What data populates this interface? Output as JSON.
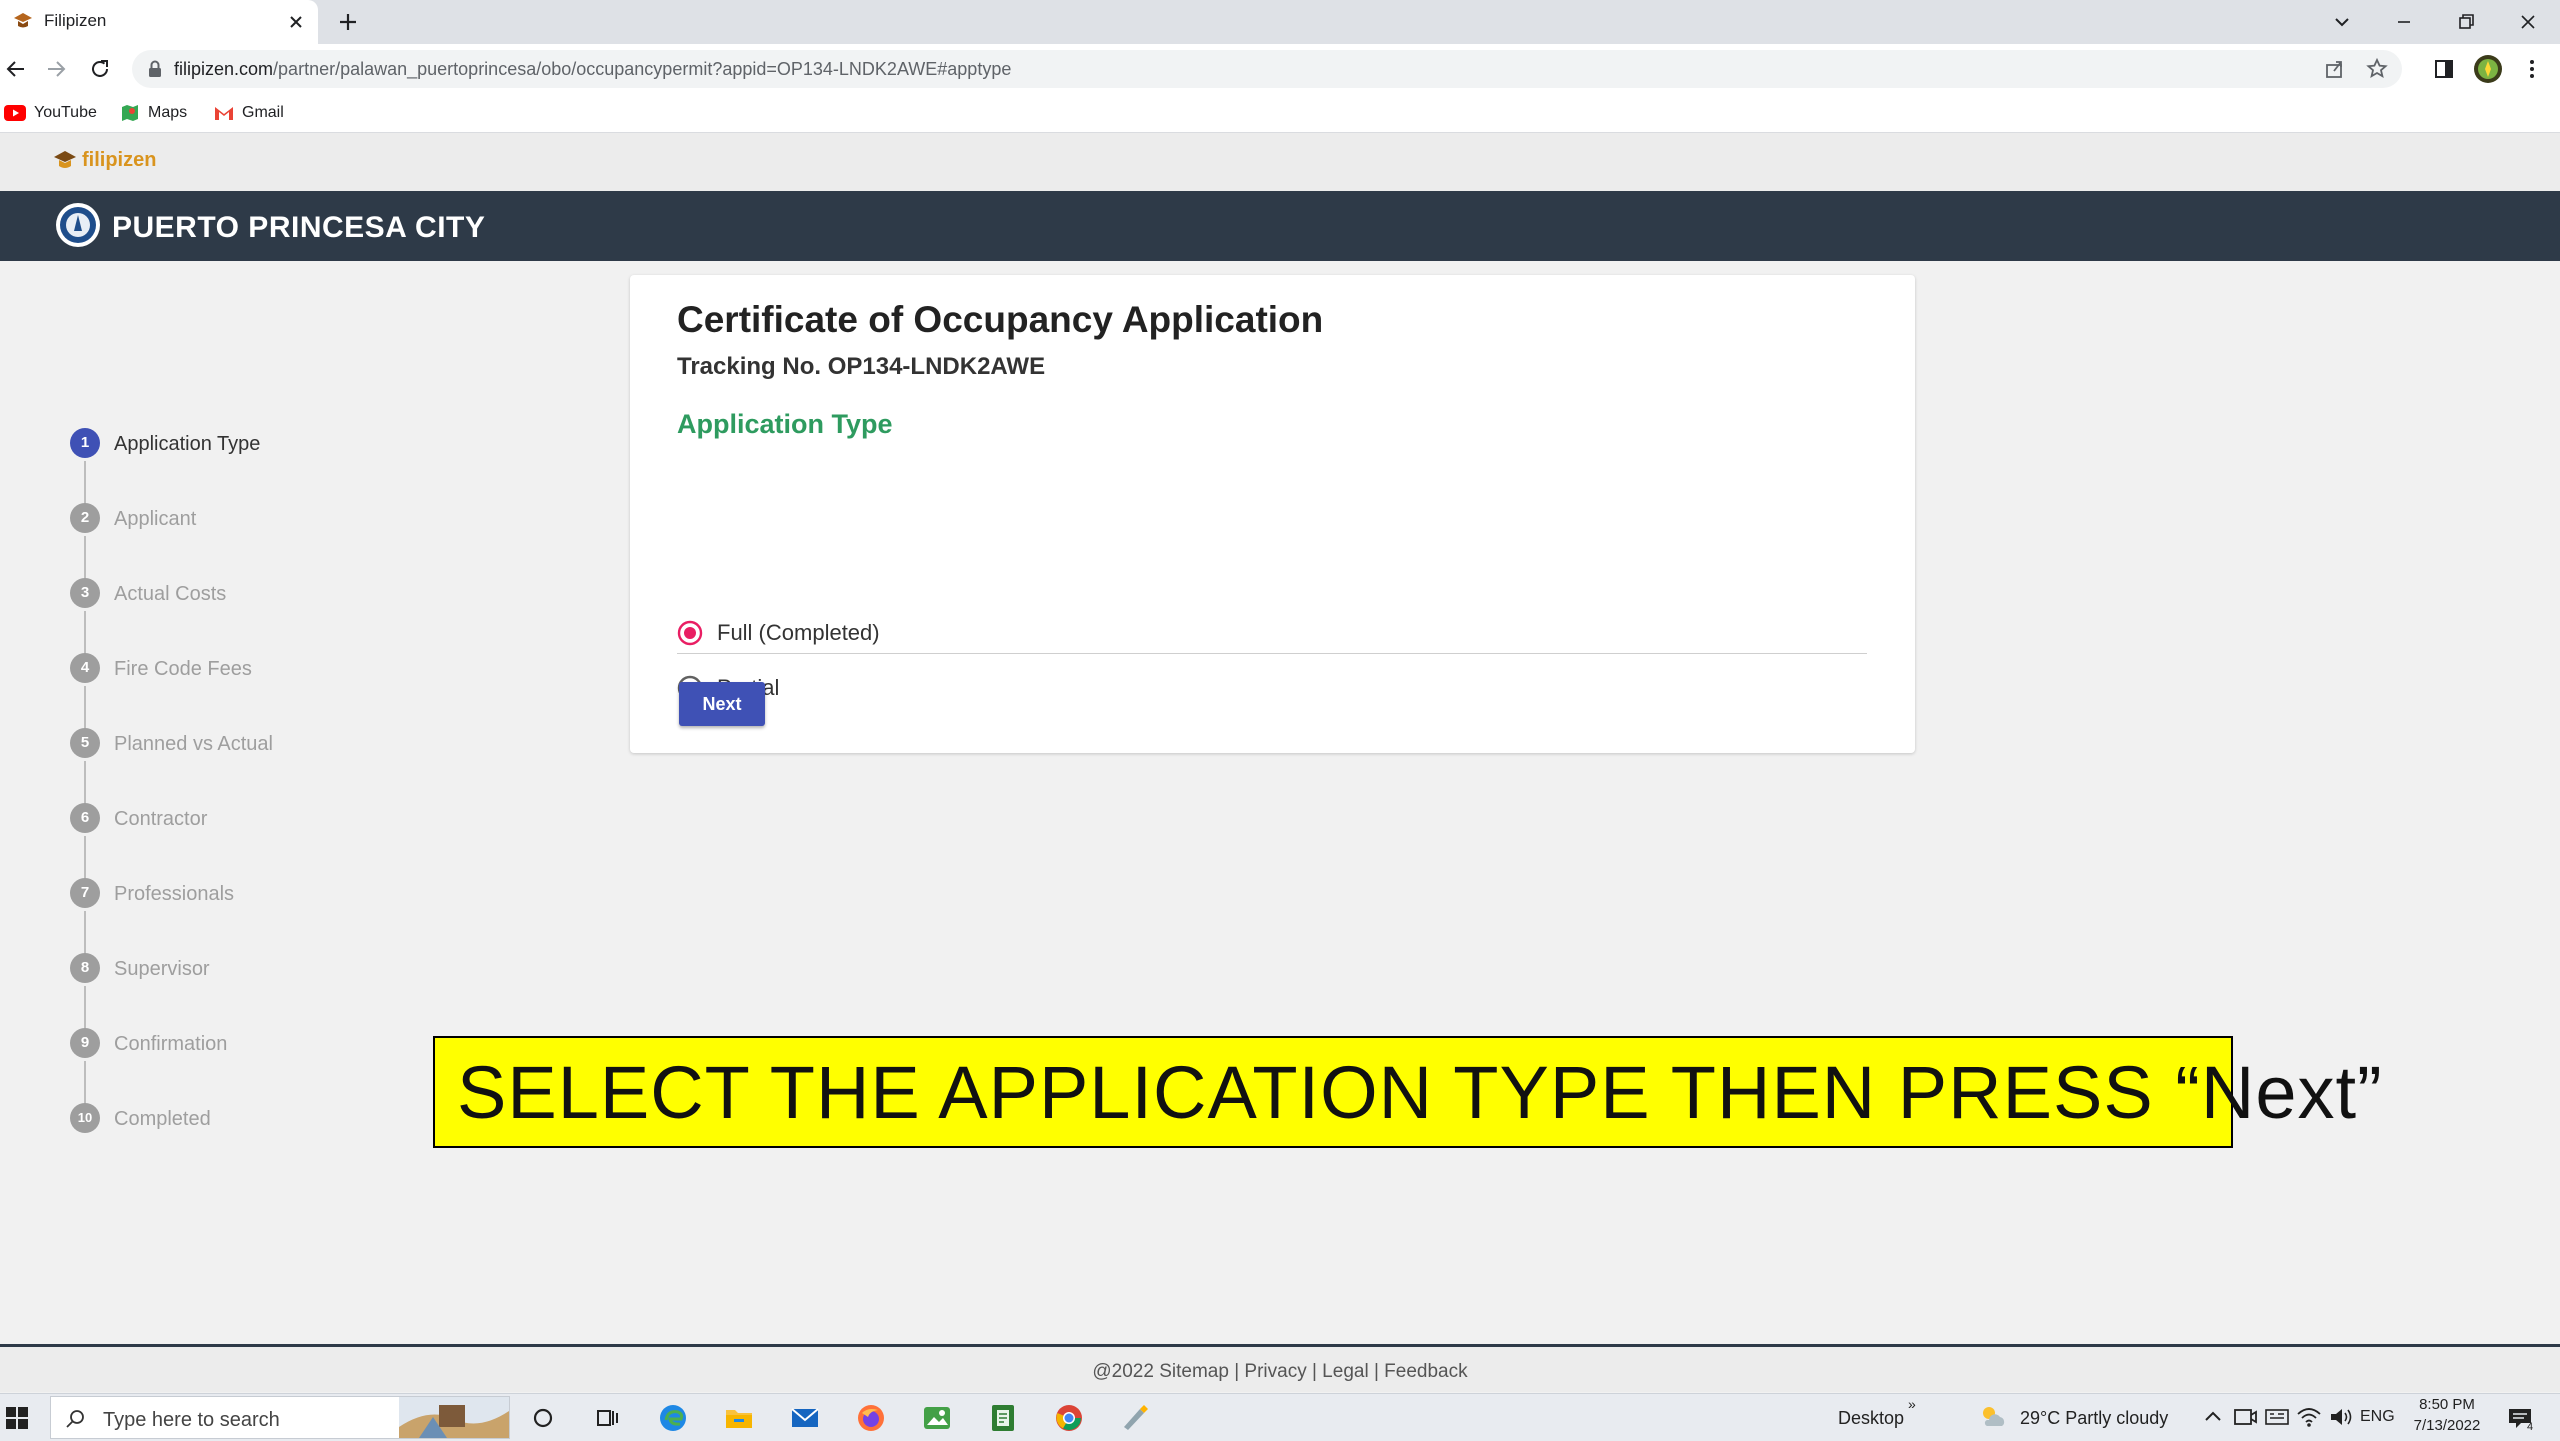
{
  "browser": {
    "tab_title": "Filipizen",
    "url_host": "filipizen.com",
    "url_path": "/partner/palawan_puertoprincesa/obo/occupancypermit?appid=OP134-LNDK2AWE#apptype",
    "bookmarks": [
      "YouTube",
      "Maps",
      "Gmail"
    ]
  },
  "site": {
    "brand": "filipizen",
    "city": "PUERTO PRINCESA CITY"
  },
  "steps": [
    {
      "num": "1",
      "label": "Application Type",
      "active": true
    },
    {
      "num": "2",
      "label": "Applicant"
    },
    {
      "num": "3",
      "label": "Actual Costs"
    },
    {
      "num": "4",
      "label": "Fire Code Fees"
    },
    {
      "num": "5",
      "label": "Planned vs Actual"
    },
    {
      "num": "6",
      "label": "Contractor"
    },
    {
      "num": "7",
      "label": "Professionals"
    },
    {
      "num": "8",
      "label": "Supervisor"
    },
    {
      "num": "9",
      "label": "Confirmation"
    },
    {
      "num": "10",
      "label": "Completed"
    }
  ],
  "form": {
    "title": "Certificate of Occupancy Application",
    "tracking": "Tracking No. OP134-LNDK2AWE",
    "section": "Application Type",
    "options": [
      {
        "label": "Full (Completed)",
        "selected": true
      },
      {
        "label": "Partial",
        "selected": false
      }
    ],
    "next_label": "Next"
  },
  "annotation": "SELECT THE APPLICATION TYPE THEN PRESS “Next”",
  "footer": "@2022 Sitemap | Privacy | Legal | Feedback",
  "taskbar": {
    "search_placeholder": "Type here to search",
    "desktop_label": "Desktop",
    "weather": "29°C  Partly cloudy",
    "lang": "ENG",
    "time": "8:50 PM",
    "date": "7/13/2022",
    "notification_count": "4"
  },
  "colors": {
    "accent": "#3f51b5",
    "radio_selected": "#e91e63",
    "section_green": "#2e9b5f",
    "city_bar": "#2e3a48",
    "banner": "#ffff00"
  }
}
